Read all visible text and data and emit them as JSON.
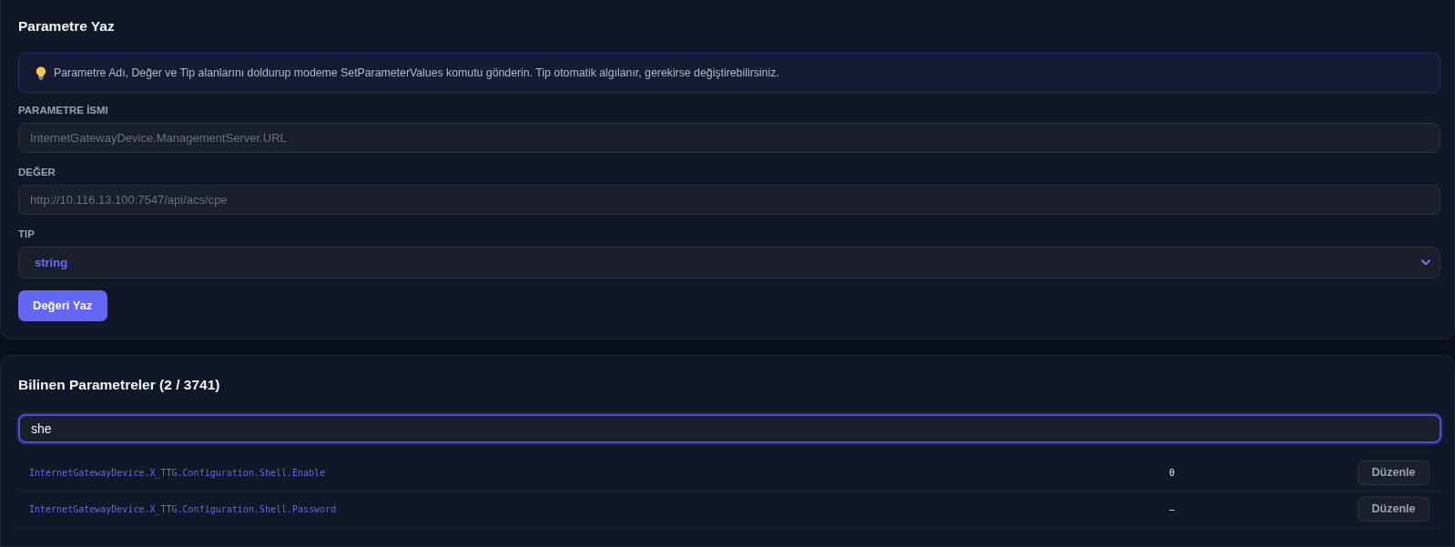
{
  "write_panel": {
    "title": "Parametre Yaz",
    "info": "Parametre Adı, Değer ve Tip alanlarını doldurup modeme SetParameterValues komutu gönderin. Tip otomatik algılanır, gerekirse değiştirebilirsiniz.",
    "fields": [
      {
        "kind": "text",
        "label": "PARAMETRE İSMI",
        "placeholder": "InternetGatewayDevice.ManagementServer.URL"
      },
      {
        "kind": "text",
        "label": "DEĞER",
        "placeholder": "http://10.116.13.100:7547/api/acs/cpe"
      },
      {
        "kind": "select",
        "label": "TIP",
        "value": "string"
      }
    ],
    "submit_button": "Değeri Yaz"
  },
  "known_panel": {
    "title": "Bilinen Parametreler (2 / 3741)",
    "search": {
      "value": "she",
      "focused": true
    },
    "rows": [
      {
        "name": "InternetGatewayDevice.X_TTG.Configuration.Shell.Enable",
        "value": "0",
        "action": "Düzenle"
      },
      {
        "name": "InternetGatewayDevice.X_TTG.Configuration.Shell.Password",
        "value": "—",
        "action": "Düzenle"
      }
    ]
  }
}
